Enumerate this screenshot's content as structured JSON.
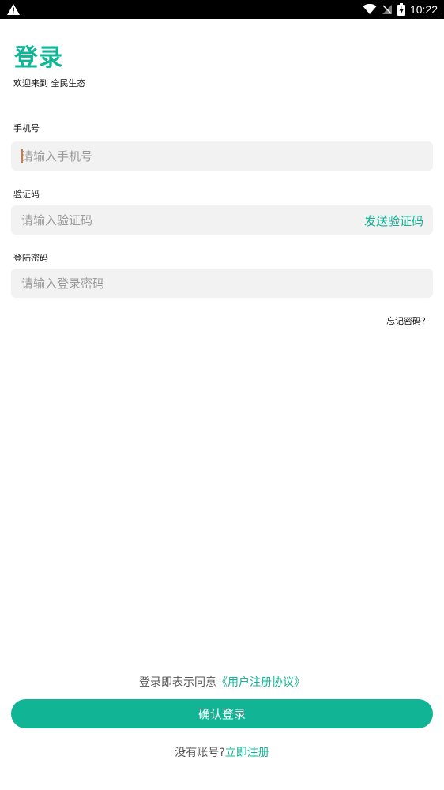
{
  "status_bar": {
    "time": "10:22",
    "icons": [
      "warning-icon",
      "wifi-icon",
      "no-signal-icon",
      "battery-charging-icon"
    ]
  },
  "page": {
    "title": "登录",
    "welcome": "欢迎来到 全民生态"
  },
  "form": {
    "phone": {
      "label": "手机号",
      "placeholder": "请输入手机号",
      "value": ""
    },
    "code": {
      "label": "验证码",
      "placeholder": "请输入验证码",
      "value": "",
      "send_label": "发送验证码"
    },
    "password": {
      "label": "登陆密码",
      "placeholder": "请输入登录密码",
      "value": ""
    },
    "forgot_label": "忘记密码？"
  },
  "footer": {
    "agreement_prefix": "登录即表示同意",
    "agreement_link": "《用户注册协议》",
    "login_label": "确认登录",
    "register_prefix": "没有账号?",
    "register_link": "立即注册"
  },
  "colors": {
    "accent": "#11b495",
    "input_bg": "#f2f2f2",
    "status_bar": "#000000"
  }
}
